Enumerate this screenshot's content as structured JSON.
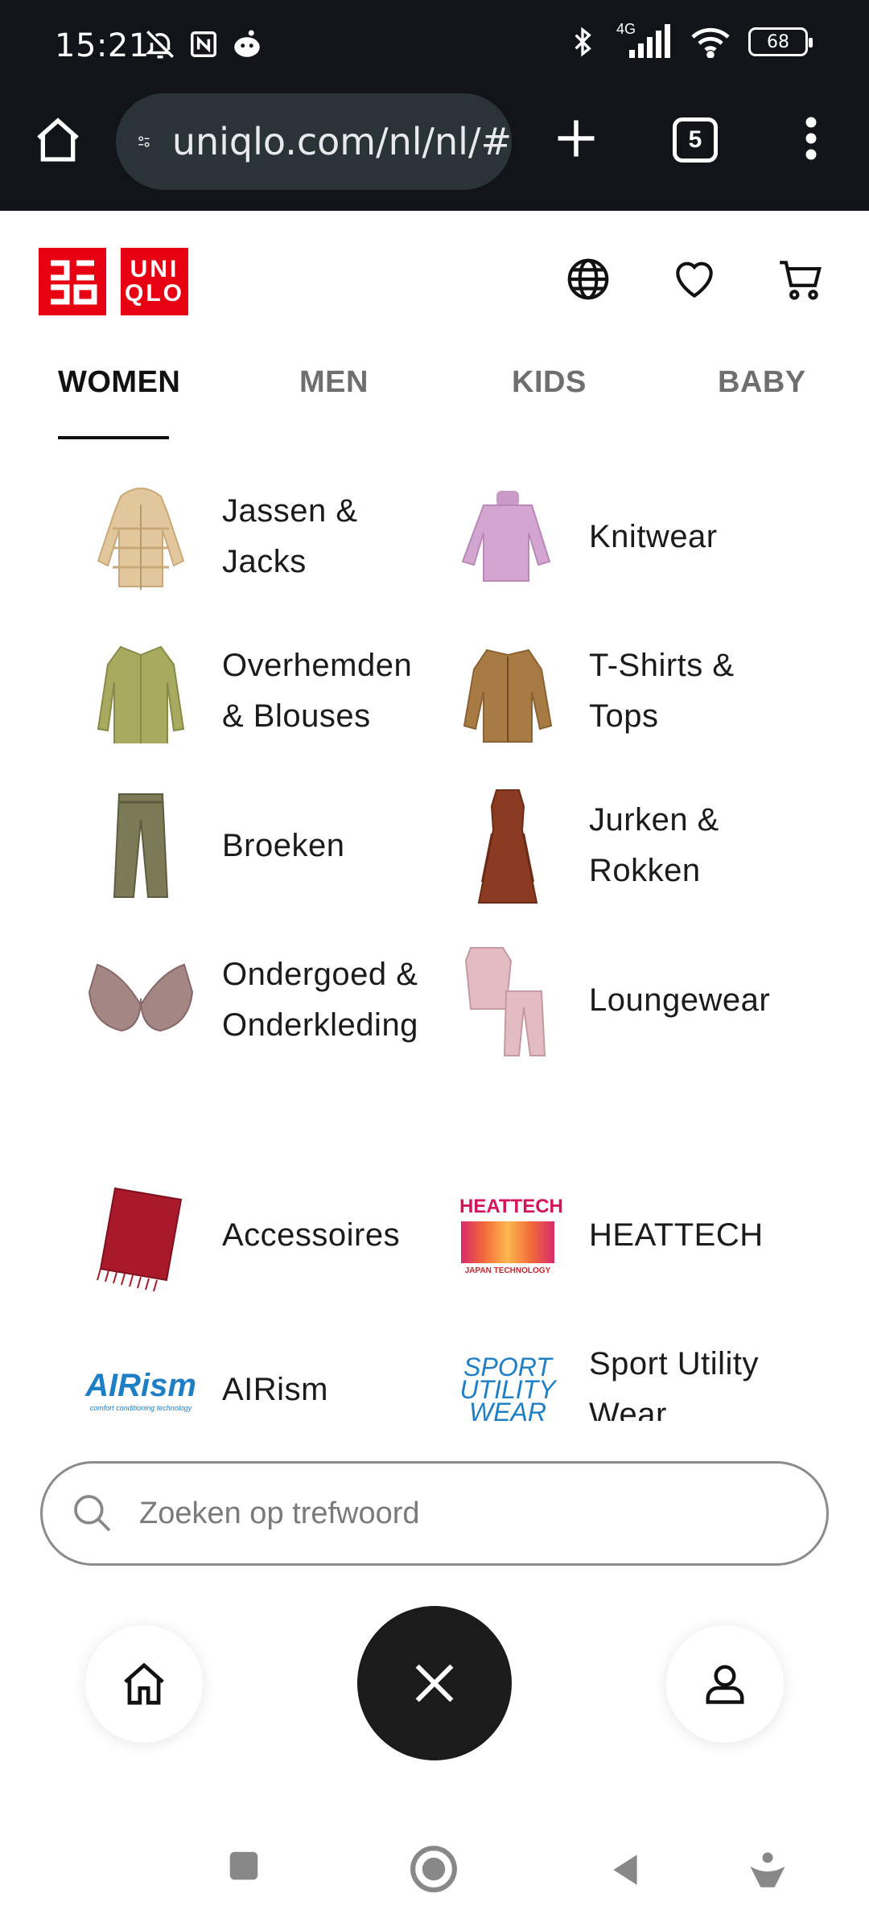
{
  "status_bar": {
    "time": "15:21",
    "network": "4G",
    "battery": "68",
    "left_icons": [
      "bell-off-icon",
      "nfc-icon",
      "app-notification-icon"
    ],
    "right_icons": [
      "bluetooth-icon",
      "cell-signal-icon",
      "wifi-icon",
      "battery-icon"
    ]
  },
  "browser": {
    "url": "uniqlo.com/nl/nl/#",
    "tab_count": "5"
  },
  "site": {
    "logo_top": "ユニ",
    "logo_bottom": "クロ",
    "logo_en_top": "UNI",
    "logo_en_bottom": "QLO",
    "header_icons": [
      "globe-icon",
      "heart-icon",
      "cart-icon"
    ]
  },
  "tabs": {
    "women": "WOMEN",
    "men": "MEN",
    "kids": "KIDS",
    "baby": "BABY",
    "active": "WOMEN"
  },
  "categories": [
    {
      "label": "Jassen & Jacks",
      "image": "puffer-jacket"
    },
    {
      "label": "Knitwear",
      "image": "turtleneck-sweater"
    },
    {
      "label": "Overhemden & Blouses",
      "image": "blouse"
    },
    {
      "label": "T-Shirts & Tops",
      "image": "fleece-jacket"
    },
    {
      "label": "Broeken",
      "image": "trousers"
    },
    {
      "label": "Jurken & Rokken",
      "image": "dress"
    },
    {
      "label": "Ondergoed & Onderkleding",
      "image": "bra"
    },
    {
      "label": "Loungewear",
      "image": "pajamas"
    },
    {
      "label": "Accessoires",
      "image": "scarf"
    },
    {
      "label": "HEATTECH",
      "image": "heattech-logo"
    },
    {
      "label": "AIRism",
      "image": "airism-logo"
    },
    {
      "label": "Sport Utility Wear",
      "image": "sport-utility-wear-logo"
    }
  ],
  "heattech_logo": {
    "title": "HEATTECH",
    "sub": "JAPAN TECHNOLOGY"
  },
  "airism_logo": {
    "title": "AIRism",
    "sub": "comfort conditioning technology"
  },
  "suw_logo": {
    "line1": "SPORT",
    "line2": "UTILITY",
    "line3": "WEAR"
  },
  "search": {
    "placeholder": "Zoeken op trefwoord"
  },
  "bottom_nav": [
    "home-icon",
    "close-icon",
    "account-icon"
  ],
  "colors": {
    "brand_red": "#e60012",
    "chrome_bg": "#111418",
    "url_pill": "#2a3438"
  }
}
